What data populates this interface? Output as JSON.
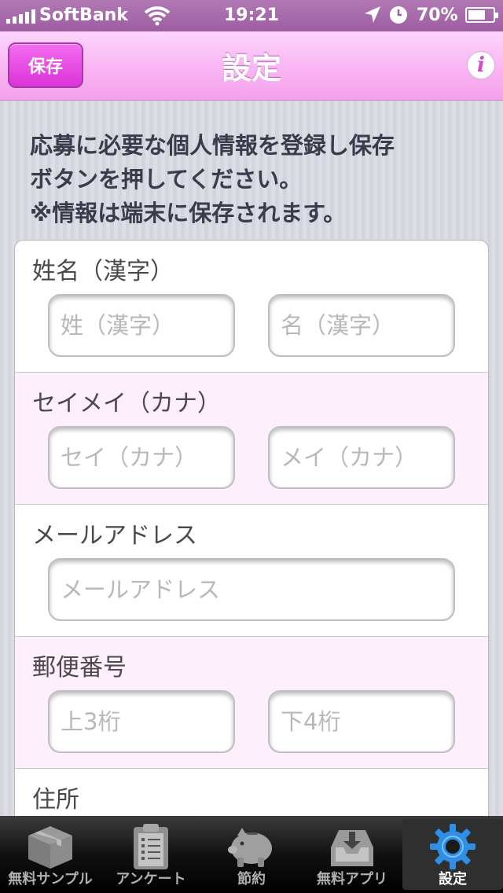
{
  "status_bar": {
    "carrier": "SoftBank",
    "time": "19:21",
    "battery": "70%",
    "battery_level": 0.7
  },
  "nav": {
    "save_label": "保存",
    "title": "設定",
    "info_icon": "i"
  },
  "intro": {
    "line1": "応募に必要な個人情報を登録し保存",
    "line2": "ボタンを押してください。",
    "line3": "※情報は端末に保存されます。"
  },
  "form": {
    "name_kanji": {
      "label": "姓名（漢字）",
      "last_placeholder": "姓（漢字）",
      "first_placeholder": "名（漢字）"
    },
    "name_kana": {
      "label": "セイメイ（カナ）",
      "last_placeholder": "セイ（カナ）",
      "first_placeholder": "メイ（カナ）"
    },
    "email": {
      "label": "メールアドレス",
      "placeholder": "メールアドレス"
    },
    "postal_code": {
      "label": "郵便番号",
      "first_placeholder": "上3桁",
      "second_placeholder": "下4桁"
    },
    "address": {
      "label": "住所"
    }
  },
  "tabs": [
    {
      "label": "無料サンプル",
      "icon": "box-icon"
    },
    {
      "label": "アンケート",
      "icon": "clipboard-icon"
    },
    {
      "label": "節約",
      "icon": "piggy-bank-icon"
    },
    {
      "label": "無料アプリ",
      "icon": "download-tray-icon"
    },
    {
      "label": "設定",
      "icon": "gear-icon",
      "active": true
    }
  ],
  "colors": {
    "nav_pink": "#f9b4f3",
    "save_button": "#e443e0",
    "status_purple": "#9d5da2",
    "row_pink": "#fdf0fc",
    "active_tab_icon": "#2f8fe6"
  }
}
